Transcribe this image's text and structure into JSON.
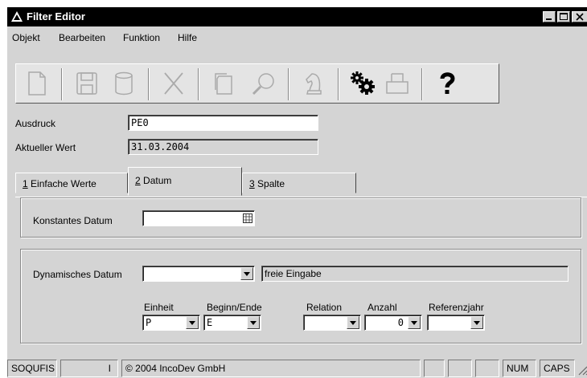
{
  "window": {
    "title": "Filter Editor"
  },
  "menu": [
    "Objekt",
    "Bearbeiten",
    "Funktion",
    "Hilfe"
  ],
  "toolbar_icons": [
    "new-document-icon",
    "save-icon",
    "database-icon",
    "delete-icon",
    "copy-icon",
    "search-icon",
    "chess-knight-icon",
    "settings-gears-icon",
    "printer-icon",
    "help-icon"
  ],
  "form": {
    "ausdruck_label": "Ausdruck",
    "ausdruck_value": "PE0",
    "wert_label": "Aktueller Wert",
    "wert_value": "31.03.2004"
  },
  "tabs": [
    {
      "key": "1",
      "label": " Einfache Werte"
    },
    {
      "key": "2",
      "label": " Datum"
    },
    {
      "key": "3",
      "label": " Spalte"
    }
  ],
  "datum": {
    "konstant_label": "Konstantes Datum",
    "konstant_value": "",
    "dynamisch_label": "Dynamisches Datum",
    "dynamisch_value": "",
    "freie_eingabe": "freie Eingabe",
    "einheit_label": "Einheit",
    "einheit_value": "P",
    "beginn_label": "Beginn/Ende",
    "beginn_value": "E",
    "relation_label": "Relation",
    "relation_value": "",
    "anzahl_label": "Anzahl",
    "anzahl_value": "0",
    "referenzjahr_label": "Referenzjahr",
    "referenzjahr_value": ""
  },
  "status": {
    "app": "SOQUFIS",
    "indicator": "I",
    "copyright": "© 2004 IncoDev GmbH",
    "num": "NUM",
    "caps": "CAPS"
  }
}
